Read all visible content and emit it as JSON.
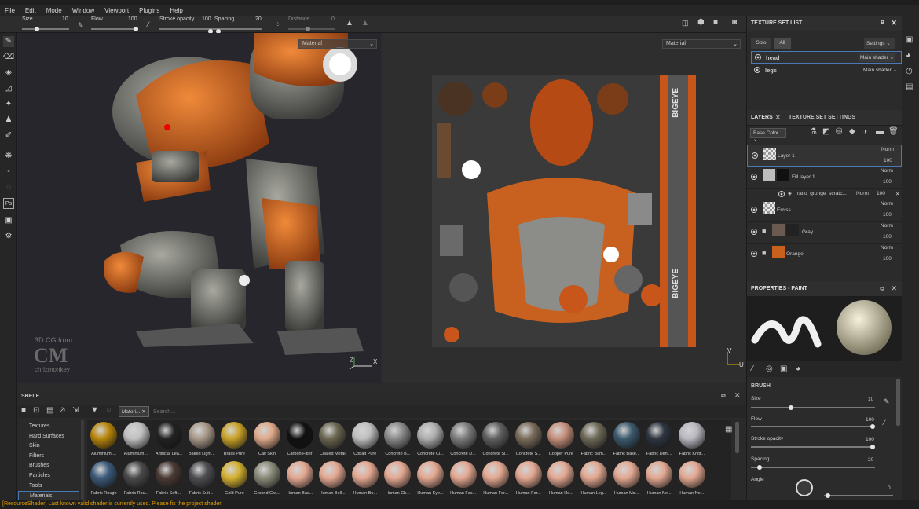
{
  "window": {
    "title": "Substance Painter"
  },
  "menu": [
    "File",
    "Edit",
    "Mode",
    "Window",
    "Viewport",
    "Plugins",
    "Help"
  ],
  "toolbar": {
    "size_label": "Size",
    "size_value": "10",
    "flow_label": "Flow",
    "flow_value": "100",
    "stroke_label": "Stroke opacity",
    "stroke_value": "100",
    "spacing_label": "Spacing",
    "spacing_value": "20",
    "distance_label": "Distance",
    "distance_value": "0"
  },
  "viewport3d": {
    "material_select": "Material",
    "watermark_line1": "3D CG from",
    "watermark_logo": "CM",
    "watermark_name": "chrizmonkey",
    "axis_z": "Z",
    "axis_x": "X"
  },
  "viewport2d": {
    "material_select": "Material",
    "axis_v": "V",
    "axis_u": "U",
    "uv_text_top": "BIGEYE",
    "uv_text_bottom": "BIGEYE"
  },
  "texture_set_list": {
    "title": "TEXTURE SET LIST",
    "solo": "Solo",
    "all": "All",
    "settings": "Settings",
    "sets": [
      {
        "name": "head",
        "shader": "Main shader"
      },
      {
        "name": "legs",
        "shader": "Main shader"
      }
    ]
  },
  "layers": {
    "tab1": "LAYERS",
    "tab2": "TEXTURE SET SETTINGS",
    "channel": "Base Color",
    "items": [
      {
        "name": "Layer 1",
        "blend": "Norm",
        "opacity": "100"
      },
      {
        "name": "Fill layer 1",
        "blend": "Norm",
        "opacity": "100"
      },
      {
        "name": "ratio_grunge_scratc...",
        "blend": "Norm",
        "opacity": "100"
      },
      {
        "name": "Emiss",
        "blend": "Norm",
        "opacity": "100"
      },
      {
        "name": "Gray",
        "blend": "Norm",
        "opacity": "100"
      },
      {
        "name": "Orange",
        "blend": "Norm",
        "opacity": "100"
      }
    ]
  },
  "properties": {
    "title": "PROPERTIES - PAINT",
    "brush": "BRUSH",
    "size_label": "Size",
    "size_value": "10",
    "flow_label": "Flow",
    "flow_value": "100",
    "stroke_label": "Stroke opacity",
    "stroke_value": "100",
    "spacing_label": "Spacing",
    "spacing_value": "20",
    "angle_label": "Angle",
    "angle_value": "0"
  },
  "shelf": {
    "title": "SHELF",
    "filter_tag": "Materi...",
    "search_placeholder": "Search...",
    "categories": [
      "Textures",
      "Hard Surfaces",
      "Skin",
      "Filters",
      "Brushes",
      "Particles",
      "Tools",
      "Materials"
    ],
    "row1": [
      "Aluminium ...",
      "Aluminium ...",
      "Artificial Lea...",
      "Baked Light...",
      "Brass Pure",
      "Calf Skin",
      "Carbon Fiber",
      "Coated Metal",
      "Cobalt Pure",
      "Concrete B...",
      "Concrete Cl...",
      "Concrete D...",
      "Concrete Si...",
      "Concrete S...",
      "Copper Pure",
      "Fabric Bam...",
      "Fabric Base...",
      "Fabric Deni...",
      "Fabric Knitt..."
    ],
    "row2": [
      "Fabric Rough",
      "Fabric Rou...",
      "Fabric Soft ...",
      "Fabric Suit ...",
      "Gold Pure",
      "Ground Gra...",
      "Human Bac...",
      "Human Bell...",
      "Human Bu...",
      "Human Ch...",
      "Human Eye...",
      "Human Fac...",
      "Human For...",
      "Human For...",
      "Human He...",
      "Human Leg...",
      "Human Mo...",
      "Human Ne...",
      "Human Ne..."
    ],
    "row1_colors": [
      "#b8860b",
      "#c0c0c0",
      "#222",
      "#a89888",
      "#c9a227",
      "#e0a98a",
      "#111",
      "#6b6650",
      "#bfbfbf",
      "#8a8a8a",
      "#aeaeae",
      "#7c7c7c",
      "#606060",
      "#7a6c5a",
      "#c58f7b",
      "#6e6a58",
      "#3c5a6e",
      "#2e3540",
      "#b8b8c0"
    ],
    "row2_colors": [
      "#3b5a7a",
      "#4a4a4a",
      "#4a3a34",
      "#4e4e52",
      "#d4b030",
      "#8a8a7a",
      "#e3a892",
      "#e3a892",
      "#e3a892",
      "#e3a892",
      "#e3a892",
      "#e3a892",
      "#e3a892",
      "#e3a892",
      "#e3a892",
      "#e3a892",
      "#e3a892",
      "#e3a892",
      "#e3a892"
    ]
  },
  "status": {
    "message": "[ResourceShader] Last known valid shader is currently used. Please fix the project shader."
  }
}
